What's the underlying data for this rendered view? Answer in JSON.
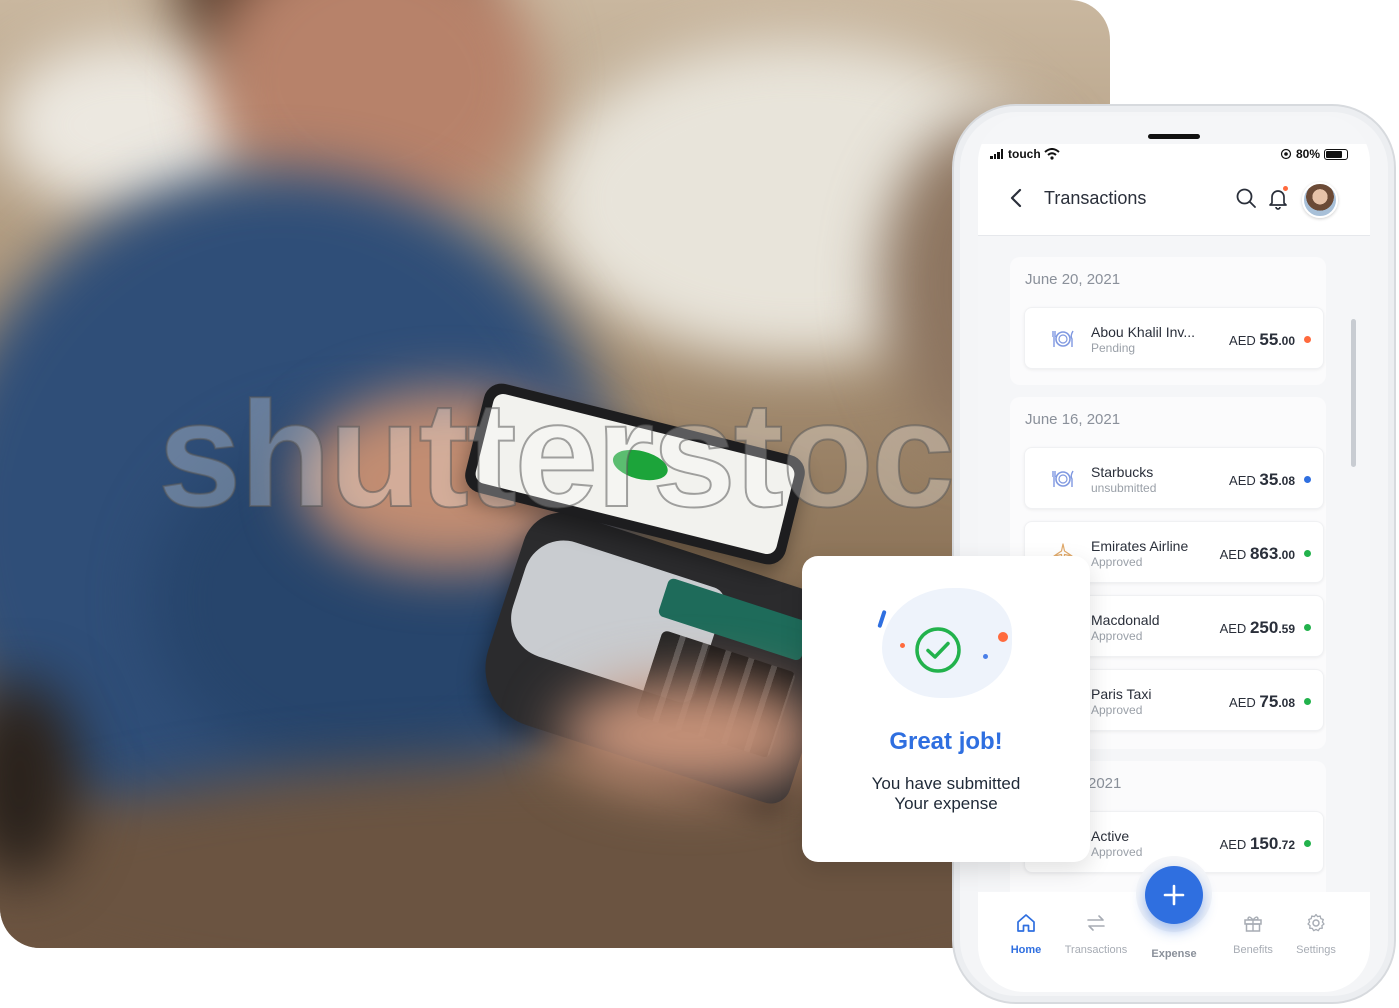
{
  "photo": {
    "watermark": "shutterstock"
  },
  "phone": {
    "status": {
      "carrier": "touch",
      "battery": "80%",
      "battery_level": 0.8
    },
    "header": {
      "title": "Transactions"
    },
    "groups": [
      {
        "date": "June 20, 2021",
        "transactions": [
          {
            "name": "Abou Khalil Inv...",
            "status": "Pending",
            "currency": "AED",
            "whole": "55",
            "fraction": ".00",
            "status_color": "#ff6a3d",
            "icon": "restaurant-icon"
          }
        ]
      },
      {
        "date": "June 16, 2021",
        "transactions": [
          {
            "name": "Starbucks",
            "status": "unsubmitted",
            "currency": "AED",
            "whole": "35",
            "fraction": ".08",
            "status_color": "#2f6fe0",
            "icon": "restaurant-icon"
          },
          {
            "name": "Emirates Airline",
            "status": "Approved",
            "currency": "AED",
            "whole": "863",
            "fraction": ".00",
            "status_color": "#22b24c",
            "icon": "airplane-icon"
          },
          {
            "name": "Macdonald",
            "status": "Approved",
            "currency": "AED",
            "whole": "250",
            "fraction": ".59",
            "status_color": "#22b24c",
            "icon": "restaurant-icon"
          },
          {
            "name": "Paris Taxi",
            "status": "Approved",
            "currency": "AED",
            "whole": "75",
            "fraction": ".08",
            "status_color": "#22b24c",
            "icon": "taxi-icon"
          }
        ]
      },
      {
        "date": "2021",
        "transactions": [
          {
            "name": "Active",
            "status": "Approved",
            "currency": "AED",
            "whole": "150",
            "fraction": ".72",
            "status_color": "#22b24c",
            "icon": "gym-icon"
          }
        ]
      }
    ],
    "tabs": [
      {
        "label": "Home",
        "icon": "home-icon",
        "active": true
      },
      {
        "label": "Transactions",
        "icon": "transfer-icon",
        "active": false
      },
      {
        "label": "Expense",
        "icon": "plus-icon",
        "active": false
      },
      {
        "label": "Benefits",
        "icon": "gift-icon",
        "active": false
      },
      {
        "label": "Settings",
        "icon": "gear-icon",
        "active": false
      }
    ],
    "accent_color": "#2f6fe0"
  },
  "success_card": {
    "title": "Great job!",
    "message_line1": "You have submitted",
    "message_line2": "Your expense",
    "icon": "check-circle-icon"
  }
}
